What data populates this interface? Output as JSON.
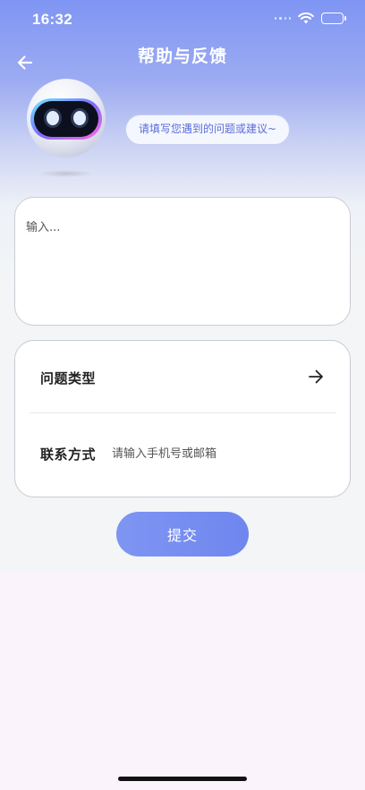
{
  "status_bar": {
    "time": "16:32",
    "icons": [
      "cellular-dots-icon",
      "wifi-icon",
      "battery-icon"
    ]
  },
  "header": {
    "title": "帮助与反馈",
    "back_icon": "arrow-left-icon"
  },
  "mascot": {
    "speech": "请填写您遇到的问题或建议~"
  },
  "feedback": {
    "placeholder": "输入...",
    "value": ""
  },
  "form": {
    "type_label": "问题类型",
    "type_icon": "arrow-right-icon",
    "contact_label": "联系方式",
    "contact_placeholder": "请输入手机号或邮箱",
    "contact_value": ""
  },
  "submit": {
    "label": "提交"
  },
  "colors": {
    "accent": "#7f95f3",
    "speech_text": "#5b6dd8",
    "page_bg": "#fbf3fb"
  }
}
